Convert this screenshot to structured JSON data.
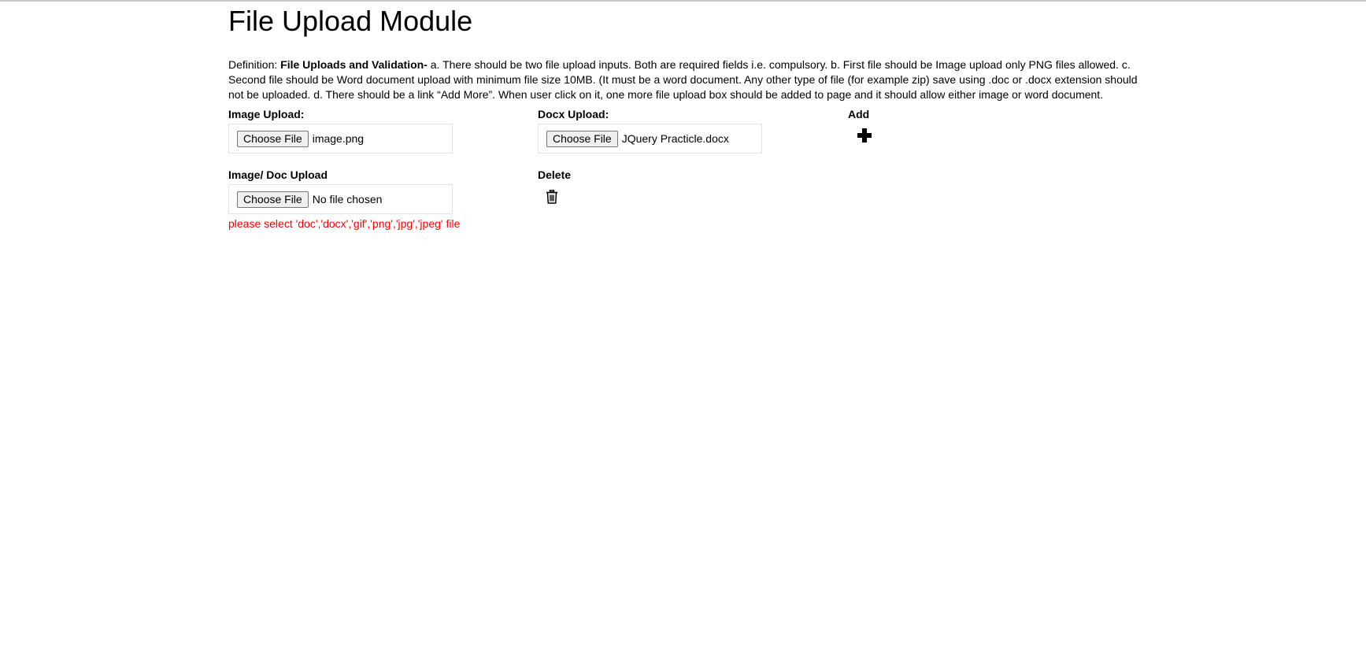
{
  "page": {
    "title": "File Upload Module",
    "definition": {
      "prefix": "Definition: ",
      "bold": "File Uploads and Validation- ",
      "text": "a. There should be two file upload inputs. Both are required fields i.e. compulsory. b. First file should be Image upload only PNG files allowed. c. Second file should be Word document upload with minimum file size 10MB. (It must be a word document. Any other type of file (for example zip) save using .doc or .docx extension should not be uploaded. d. There should be a link “Add More”. When user click on it, one more file upload box should be added to page and it should allow either image or word document."
    }
  },
  "row1": {
    "image_upload": {
      "label": "Image Upload:",
      "button": "Choose File",
      "file_name": "image.png"
    },
    "docx_upload": {
      "label": "Docx Upload:",
      "button": "Choose File",
      "file_name": "JQuery Practicle.docx"
    },
    "add": {
      "label": "Add",
      "icon": "plus-icon"
    }
  },
  "row2": {
    "image_doc_upload": {
      "label": "Image/ Doc Upload",
      "button": "Choose File",
      "file_name": "No file chosen",
      "error": "please select 'doc','docx','gif','png','jpg','jpeg' file"
    },
    "delete": {
      "label": "Delete",
      "icon": "trash-icon"
    }
  },
  "colors": {
    "error": "#ff0000",
    "border": "#e3e3e3",
    "button_bg": "#efefef"
  }
}
